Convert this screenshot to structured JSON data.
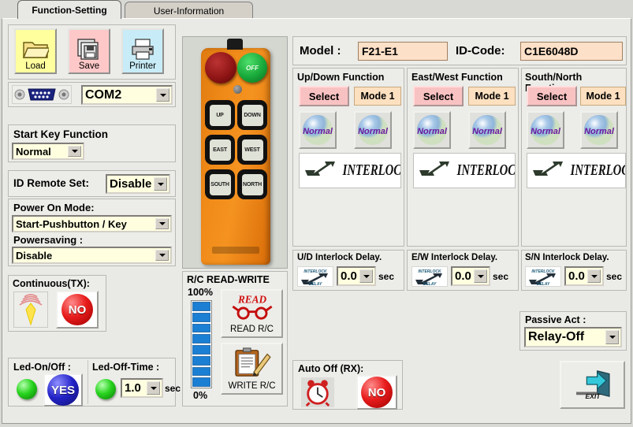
{
  "window": {
    "tabs": [
      {
        "label": "Function-Setting",
        "active": true
      },
      {
        "label": "User-Information",
        "active": false
      }
    ]
  },
  "toolbar": {
    "load_label": "Load",
    "save_label": "Save",
    "printer_label": "Printer",
    "load_icon": "folder-icon",
    "save_icon": "floppy-disk-icon",
    "printer_icon": "printer-icon"
  },
  "port": {
    "icon": "serial-db9-connector-icon",
    "value": "COM2"
  },
  "start_key": {
    "title": "Start Key Function",
    "value": "Normal"
  },
  "id_remote": {
    "label": "ID Remote Set:",
    "value": "Disable"
  },
  "power_on": {
    "label": "Power On Mode:",
    "value": "Start-Pushbutton / Key",
    "powersaving_label": "Powersaving  :",
    "powersaving_value": "Disable"
  },
  "continuous_tx": {
    "label": "Continuous(TX):",
    "antenna_icon": "antenna-signal-icon",
    "state": "NO"
  },
  "led": {
    "on_off_label": "Led-On/Off  :",
    "on_off_state": "YES",
    "off_time_label": "Led-Off-Time :",
    "off_time_value": "1.0",
    "off_time_unit": "sec",
    "led_icon": "green-led-icon"
  },
  "remote_photo": {
    "name": "radio-remote-control-photo",
    "off_knob_label": "OFF",
    "keys": [
      "UP",
      "DOWN",
      "EAST",
      "WEST",
      "SOUTH",
      "NORTH"
    ]
  },
  "rc_rw": {
    "title": "R/C READ-WRITE",
    "max_label": "100%",
    "min_label": "0%",
    "progress_percent": 100,
    "read_button": "READ  R/C",
    "read_icon": "read-glasses-icon",
    "write_button": "WRITE R/C",
    "write_icon": "clipboard-pencil-icon"
  },
  "identity": {
    "model_label": "Model  :",
    "model_value": "F21-E1",
    "idcode_label": "ID-Code:",
    "idcode_value": "C1E6048D"
  },
  "functions": [
    {
      "title": "Up/Down Function",
      "select_label": "Select",
      "mode_label": "Mode 1",
      "button_a": "Normal",
      "button_b": "Normal",
      "interlock_label": "INTERLOCK",
      "interlock_icon": "double-arrow-icon"
    },
    {
      "title": "East/West Function",
      "select_label": "Select",
      "mode_label": "Mode 1",
      "button_a": "Normal",
      "button_b": "Normal",
      "interlock_label": "INTERLOCK",
      "interlock_icon": "double-arrow-icon"
    },
    {
      "title": "South/North Function",
      "select_label": "Select",
      "mode_label": "Mode 1",
      "button_a": "Normal",
      "button_b": "Normal",
      "interlock_label": "INTERLOCK",
      "interlock_icon": "double-arrow-icon"
    }
  ],
  "delays": [
    {
      "title": "U/D Interlock Delay.",
      "value": "0.0",
      "unit": "sec",
      "icon": "interlock-delay-icon"
    },
    {
      "title": "E/W Interlock Delay.",
      "value": "0.0",
      "unit": "sec",
      "icon": "interlock-delay-icon"
    },
    {
      "title": "S/N Interlock Delay.",
      "value": "0.0",
      "unit": "sec",
      "icon": "interlock-delay-icon"
    }
  ],
  "passive_act": {
    "label": "Passive Act :",
    "value": "Relay-Off"
  },
  "auto_off": {
    "label": "Auto Off (RX):",
    "clock_icon": "alarm-clock-icon",
    "state": "NO"
  },
  "exit": {
    "label": "EXIT",
    "icon": "exit-door-arrow-icon"
  },
  "colors": {
    "window_bg": "#e9e9e5",
    "accent_pink": "#f9c2c2",
    "field_yellow": "#ffffe0",
    "field_peach": "#fde0c8",
    "progress_blue": "#1b7fd4"
  }
}
